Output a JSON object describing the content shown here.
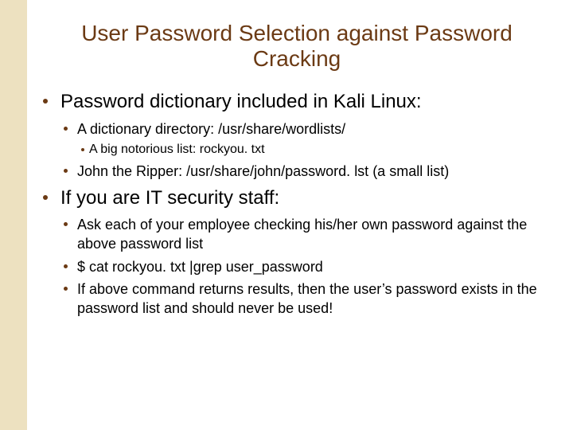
{
  "title": "User Password Selection against Password Cracking",
  "bullets": {
    "b1": "Password dictionary included in Kali Linux:",
    "b1_1": "A dictionary directory:  /usr/share/wordlists/",
    "b1_1_1": "A big notorious list: rockyou. txt",
    "b1_2": "John the Ripper:  /usr/share/john/password. lst  (a small list)",
    "b2": "If you are IT security staff:",
    "b2_1": "Ask each of your employee checking his/her own password against the above password list",
    "b2_2": "$ cat rockyou. txt |grep user_password",
    "b2_3": "If above command returns results, then the user’s password exists in the password list and should never be used!"
  }
}
